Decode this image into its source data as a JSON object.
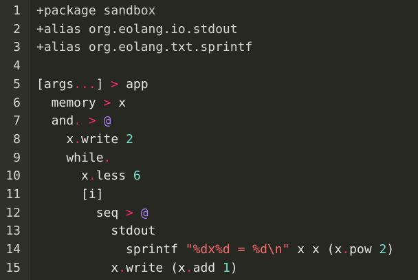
{
  "editor": {
    "lines": [
      {
        "n": "1",
        "tokens": [
          {
            "t": "+package sandbox",
            "c": "t-dim"
          }
        ]
      },
      {
        "n": "2",
        "tokens": [
          {
            "t": "+alias org.eolang.io.stdout",
            "c": "t-dim"
          }
        ]
      },
      {
        "n": "3",
        "tokens": [
          {
            "t": "+alias org.eolang.txt.sprintf",
            "c": "t-dim"
          }
        ]
      },
      {
        "n": "4",
        "tokens": []
      },
      {
        "n": "5",
        "tokens": [
          {
            "t": "[args",
            "c": "t-text"
          },
          {
            "t": "...",
            "c": "t-op"
          },
          {
            "t": "] ",
            "c": "t-text"
          },
          {
            "t": ">",
            "c": "t-op"
          },
          {
            "t": " app",
            "c": "t-text"
          }
        ]
      },
      {
        "n": "6",
        "tokens": [
          {
            "t": "  memory ",
            "c": "t-text"
          },
          {
            "t": ">",
            "c": "t-op"
          },
          {
            "t": " x",
            "c": "t-text"
          }
        ]
      },
      {
        "n": "7",
        "tokens": [
          {
            "t": "  and",
            "c": "t-text"
          },
          {
            "t": ".",
            "c": "t-op"
          },
          {
            "t": " ",
            "c": "t-text"
          },
          {
            "t": ">",
            "c": "t-op"
          },
          {
            "t": " ",
            "c": "t-text"
          },
          {
            "t": "@",
            "c": "t-at"
          }
        ]
      },
      {
        "n": "8",
        "tokens": [
          {
            "t": "    x",
            "c": "t-text"
          },
          {
            "t": ".",
            "c": "t-op"
          },
          {
            "t": "write ",
            "c": "t-text"
          },
          {
            "t": "2",
            "c": "t-num2"
          }
        ]
      },
      {
        "n": "9",
        "tokens": [
          {
            "t": "    while",
            "c": "t-text"
          },
          {
            "t": ".",
            "c": "t-op"
          }
        ]
      },
      {
        "n": "10",
        "tokens": [
          {
            "t": "      x",
            "c": "t-text"
          },
          {
            "t": ".",
            "c": "t-op"
          },
          {
            "t": "less ",
            "c": "t-text"
          },
          {
            "t": "6",
            "c": "t-num2"
          }
        ]
      },
      {
        "n": "11",
        "tokens": [
          {
            "t": "      [i]",
            "c": "t-text"
          }
        ]
      },
      {
        "n": "12",
        "tokens": [
          {
            "t": "        seq ",
            "c": "t-text"
          },
          {
            "t": ">",
            "c": "t-op"
          },
          {
            "t": " ",
            "c": "t-text"
          },
          {
            "t": "@",
            "c": "t-at"
          }
        ]
      },
      {
        "n": "13",
        "tokens": [
          {
            "t": "          stdout",
            "c": "t-text"
          }
        ]
      },
      {
        "n": "14",
        "tokens": [
          {
            "t": "            sprintf ",
            "c": "t-text"
          },
          {
            "t": "\"%dx%d = %d\\n\"",
            "c": "t-str"
          },
          {
            "t": " x x (x",
            "c": "t-text"
          },
          {
            "t": ".",
            "c": "t-op"
          },
          {
            "t": "pow ",
            "c": "t-text"
          },
          {
            "t": "2",
            "c": "t-num2"
          },
          {
            "t": ")",
            "c": "t-text"
          }
        ]
      },
      {
        "n": "15",
        "tokens": [
          {
            "t": "          x",
            "c": "t-text"
          },
          {
            "t": ".",
            "c": "t-op"
          },
          {
            "t": "write (x",
            "c": "t-text"
          },
          {
            "t": ".",
            "c": "t-op"
          },
          {
            "t": "add ",
            "c": "t-text"
          },
          {
            "t": "1",
            "c": "t-num2"
          },
          {
            "t": ")",
            "c": "t-text"
          }
        ]
      }
    ]
  },
  "colors": {
    "background": "#272822",
    "gutter": "#2f302a",
    "text": "#e6e6e6",
    "operator": "#f92672",
    "number": "#78e3cf",
    "at": "#a77cf2",
    "string": "#f36f70"
  }
}
